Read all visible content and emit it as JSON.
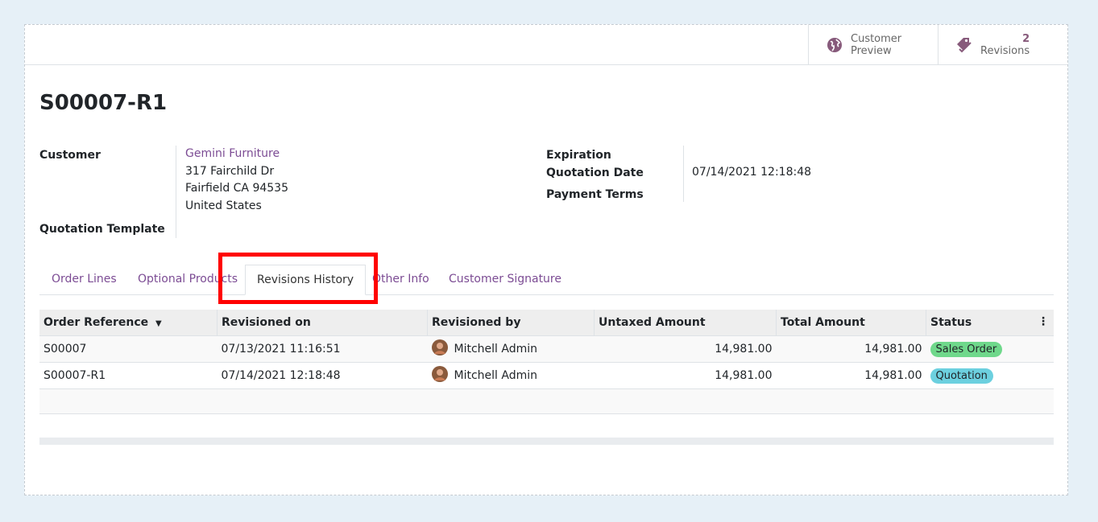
{
  "buttons": {
    "preview_line1": "Customer",
    "preview_line2": "Preview",
    "revisions_count": "2",
    "revisions_label": "Revisions"
  },
  "record": {
    "title": "S00007-R1"
  },
  "fields": {
    "customer_label": "Customer",
    "customer_name": "Gemini Furniture",
    "address_line1": "317 Fairchild Dr",
    "address_line2": "Fairfield CA 94535",
    "address_line3": "United States",
    "template_label": "Quotation Template",
    "expiration_label": "Expiration",
    "quotation_date_label": "Quotation Date",
    "quotation_date_value": "07/14/2021 12:18:48",
    "payment_terms_label": "Payment Terms"
  },
  "tabs": [
    {
      "label": "Order Lines"
    },
    {
      "label": "Optional Products"
    },
    {
      "label": "Revisions History"
    },
    {
      "label": "Other Info"
    },
    {
      "label": "Customer Signature"
    }
  ],
  "table": {
    "headers": {
      "order_ref": "Order Reference",
      "revisioned_on": "Revisioned on",
      "revisioned_by": "Revisioned by",
      "untaxed": "Untaxed Amount",
      "total": "Total Amount",
      "status": "Status"
    },
    "rows": [
      {
        "ref": "S00007",
        "on": "07/13/2021 11:16:51",
        "by": "Mitchell Admin",
        "untaxed": "14,981.00",
        "total": "14,981.00",
        "status": "Sales Order"
      },
      {
        "ref": "S00007-R1",
        "on": "07/14/2021 12:18:48",
        "by": "Mitchell Admin",
        "untaxed": "14,981.00",
        "total": "14,981.00",
        "status": "Quotation"
      }
    ]
  },
  "colors": {
    "accent": "#7c4c94",
    "sales_order_badge": "#6fd88b",
    "quotation_badge": "#6cd0df",
    "highlight": "#ff0000"
  },
  "icons": {
    "preview": "globe-icon",
    "revisions": "tags-icon",
    "sort": "caret-down-icon",
    "options": "kebab-icon"
  }
}
